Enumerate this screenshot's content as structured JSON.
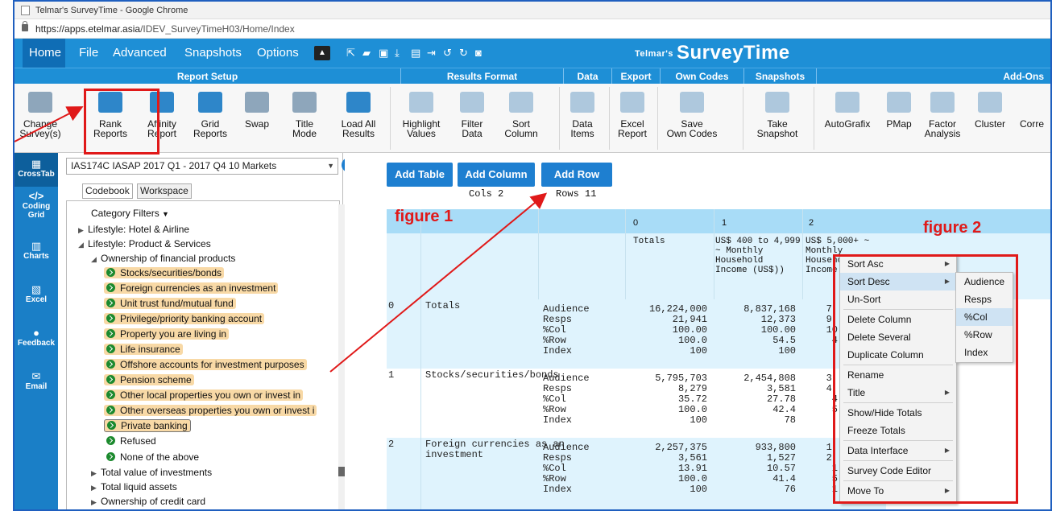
{
  "window": {
    "title": "Telmar's SurveyTime - Google Chrome",
    "url_host": "https://apps.etelmar.asia",
    "url_path": "/IDEV_SurveyTimeH03/Home/Index"
  },
  "menu": {
    "tabs": [
      "Home",
      "File",
      "Advanced",
      "Snapshots",
      "Options"
    ],
    "brand_small": "Telmar's",
    "brand": "SurveyTime"
  },
  "groups": [
    "Report Setup",
    "Results Format",
    "Data",
    "Export",
    "Own Codes",
    "Snapshots",
    "Add-Ons"
  ],
  "toolbar": {
    "change_survey": [
      "Change",
      "Survey(s)"
    ],
    "rank_reports": [
      "Rank",
      "Reports"
    ],
    "affinity_report": [
      "Affinity",
      "Report"
    ],
    "grid_reports": [
      "Grid",
      "Reports"
    ],
    "swap": [
      "Swap"
    ],
    "title_mode": [
      "Title",
      "Mode"
    ],
    "load_all_results": [
      "Load All",
      "Results"
    ],
    "highlight_values": [
      "Highlight",
      "Values"
    ],
    "filter_data": [
      "Filter",
      "Data"
    ],
    "sort_column": [
      "Sort",
      "Column"
    ],
    "data_items": [
      "Data",
      "Items"
    ],
    "excel_report": [
      "Excel",
      "Report"
    ],
    "save_own_codes": [
      "Save",
      "Own Codes"
    ],
    "take_snapshot": [
      "Take",
      "Snapshot"
    ],
    "autografix": [
      "AutoGrafix"
    ],
    "pmap": [
      "PMap"
    ],
    "factor_analysis": [
      "Factor",
      "Analysis"
    ],
    "cluster": [
      "Cluster"
    ],
    "corr": [
      "Corre"
    ]
  },
  "leftnav": [
    "CrossTab",
    "Coding Grid",
    "Charts",
    "Excel",
    "Feedback",
    "Email"
  ],
  "panel": {
    "dataset": "IAS174C IASAP 2017 Q1 - 2017 Q4 10 Markets",
    "tabs": [
      "Codebook",
      "Workspace"
    ],
    "filters_label": "Category Filters",
    "tree": [
      {
        "label": "Lifestyle: Hotel & Airline",
        "type": "folder-closed"
      },
      {
        "label": "Lifestyle: Product & Services",
        "type": "folder-open"
      },
      {
        "label": "Ownership of financial products",
        "type": "folder-open"
      },
      {
        "label": "Stocks/securities/bonds",
        "type": "code",
        "selected": true
      },
      {
        "label": "Foreign currencies as an investment",
        "type": "code",
        "selected": true
      },
      {
        "label": "Unit trust fund/mutual fund",
        "type": "code",
        "selected": true
      },
      {
        "label": "Privilege/priority banking account",
        "type": "code",
        "selected": true
      },
      {
        "label": "Property you are living in",
        "type": "code",
        "selected": true
      },
      {
        "label": "Life insurance",
        "type": "code",
        "selected": true
      },
      {
        "label": "Offshore accounts for investment purposes",
        "type": "code",
        "selected": true
      },
      {
        "label": "Pension scheme",
        "type": "code",
        "selected": true
      },
      {
        "label": "Other local properties you own or invest in",
        "type": "code",
        "selected": true
      },
      {
        "label": "Other overseas properties you own or invest i",
        "type": "code",
        "selected": true
      },
      {
        "label": "Private banking",
        "type": "code",
        "selected": true
      },
      {
        "label": "Refused",
        "type": "code",
        "selected": false
      },
      {
        "label": "None of the above",
        "type": "code",
        "selected": false
      },
      {
        "label": "Total value of investments",
        "type": "folder-closed"
      },
      {
        "label": "Total liquid assets",
        "type": "folder-closed"
      },
      {
        "label": "Ownership of credit card",
        "type": "folder-closed"
      }
    ]
  },
  "actions": {
    "add_table": "Add Table",
    "add_column": "Add Column",
    "add_row": "Add Row",
    "cols": "Cols 2",
    "rows": "Rows 11"
  },
  "table": {
    "col_indices": [
      "0",
      "1",
      "2"
    ],
    "col_titles": [
      "Totals",
      "US$ 400 to 4,999\n~ Monthly\nHousehold\nIncome (US$))",
      "US$ 5,000+ ~\nMonthly\nHouseho\nIncome ("
    ],
    "rows": [
      {
        "idx": "0",
        "label": "Totals",
        "items": "Audience\nResps\n%Col\n%Row\nIndex",
        "c0": "16,224,000\n21,941\n100.00\n100.0\n100",
        "c1": "8,837,168\n12,373\n100.00\n54.5\n100",
        "c2": "7,\n9,\n10\n4\n"
      },
      {
        "idx": "1",
        "label": "Stocks/securities/bonds",
        "items": "Audience\nResps\n%Col\n%Row\nIndex",
        "c0": "5,795,703\n8,279\n35.72\n100.0\n100",
        "c1": "2,454,808\n3,581\n27.78\n42.4\n78",
        "c2": "3,\n4,\n4\n5\n"
      },
      {
        "idx": "2",
        "label": "Foreign currencies as an\ninvestment",
        "items": "Audience\nResps\n%Col\n%Row\nIndex",
        "c0": "2,257,375\n3,561\n13.91\n100.0\n100",
        "c1": "933,800\n1,527\n10.57\n41.4\n76",
        "c2": "1,\n2,\n1\n5\n1"
      }
    ]
  },
  "context_menu": {
    "items": [
      "Sort Asc",
      "Sort Desc",
      "Un-Sort",
      "Delete Column",
      "Delete Several",
      "Duplicate Column",
      "Rename",
      "Title",
      "Show/Hide Totals",
      "Freeze Totals",
      "Data Interface",
      "Survey Code Editor",
      "Move To"
    ],
    "submenu": [
      "Audience",
      "Resps",
      "%Col",
      "%Row",
      "Index"
    ]
  },
  "annotations": {
    "figure1": "figure 1",
    "figure2": "figure 2"
  },
  "colors": {
    "menu_blue": "#1e8fd6",
    "nav_blue": "#1a7fc7",
    "header_blue": "#a8dcf7",
    "highlight": "#f8d9a6",
    "annotation_red": "#e01919"
  }
}
